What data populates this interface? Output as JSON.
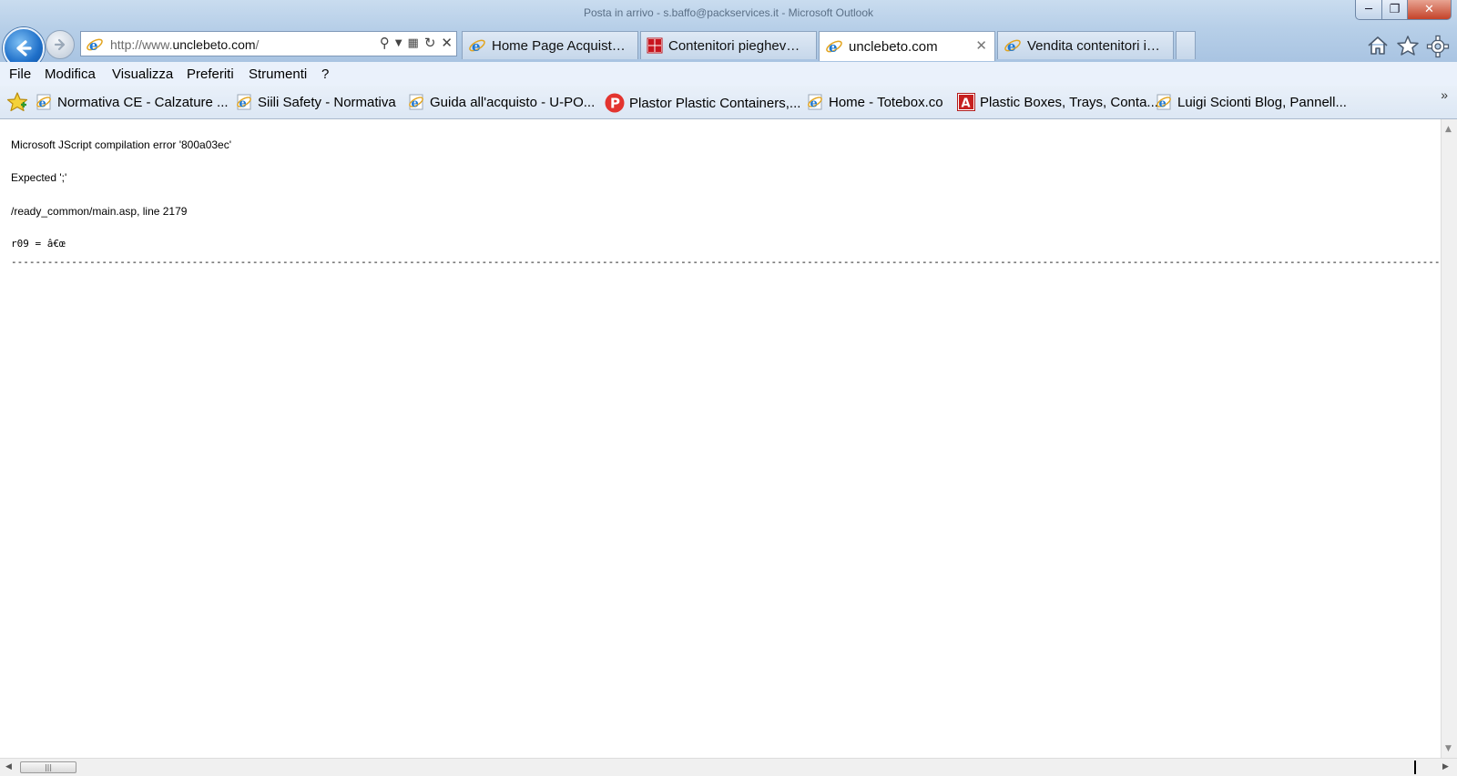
{
  "window": {
    "title": "Posta in arrivo - s.baffo@packservices.it - Microsoft Outlook"
  },
  "address_bar": {
    "url_prefix": "http://www.",
    "url_domain": "unclebeto.com",
    "url_suffix": "/"
  },
  "tabs": [
    {
      "label": "Home Page Acquistinrete",
      "icon": "ie-page-icon",
      "active": false
    },
    {
      "label": "Contenitori pieghevoli ...",
      "icon": "red-grid-icon",
      "active": false
    },
    {
      "label": "unclebeto.com",
      "icon": "ie-page-icon",
      "active": true
    },
    {
      "label": "Vendita contenitori in ...",
      "icon": "ie-page-icon",
      "active": false
    }
  ],
  "menu": [
    "File",
    "Modifica",
    "Visualizza",
    "Preferiti",
    "Strumenti",
    "?"
  ],
  "favorites": [
    {
      "label": "Normativa CE - Calzature ...",
      "icon": "ie-page-icon"
    },
    {
      "label": "Siili Safety - Normativa",
      "icon": "ie-page-icon"
    },
    {
      "label": "Guida all'acquisto - U-PO...",
      "icon": "ie-page-icon"
    },
    {
      "label": "Plastor  Plastic Containers,...",
      "icon": "plastor-p-icon"
    },
    {
      "label": "Home - Totebox.co",
      "icon": "ie-page-icon"
    },
    {
      "label": "Plastic Boxes, Trays, Conta...",
      "icon": "red-a-icon"
    },
    {
      "label": "Luigi Scionti Blog, Pannell...",
      "icon": "ie-page-icon"
    }
  ],
  "page": {
    "error_title": "Microsoft JScript compilation error '800a03ec'",
    "error_expected": "Expected ';'",
    "error_location": "/ready_common/main.asp, line 2179",
    "code_line": "r09 = â€œ",
    "dash_line": "------------------------------------------------------------------------------------------------------------------------------------------------------------------------------------------------------------------------------------------------------------------------------------------------------------------------------"
  },
  "colors": {
    "accent": "#1e6fc9",
    "chrome": "#b7cfe8",
    "menu_bg": "#eaf1fb"
  }
}
